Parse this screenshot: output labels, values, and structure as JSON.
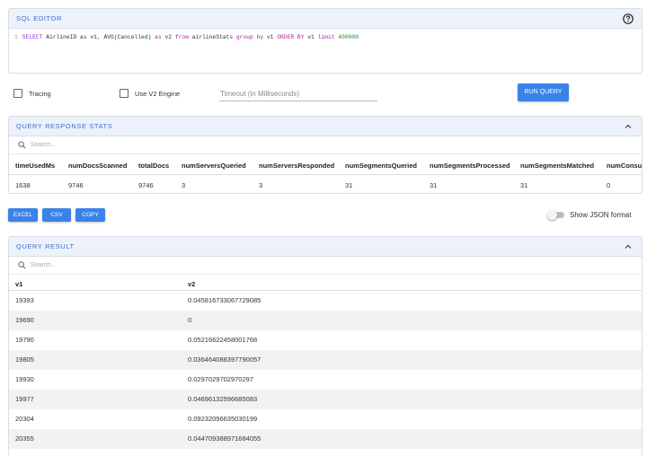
{
  "sql_editor": {
    "title": "SQL EDITOR",
    "line_number": "1",
    "query_tokens": {
      "select": "SELECT",
      "part1": " AirlineID as v1, AVG(Cancelled) ",
      "as2": "as",
      "v2": " v2 ",
      "from": "from",
      "table": " airlineStats ",
      "group": "group by",
      "v1a": " v1 ",
      "order": "ORDER BY",
      "v1b": " v1 ",
      "limit": "limit",
      "limit_value": " 400000"
    }
  },
  "options": {
    "tracing_label": "Tracing",
    "v2_engine_label": "Use V2 Engine",
    "timeout_placeholder": "Timeout (in Milliseconds)",
    "run_query_label": "RUN QUERY"
  },
  "stats": {
    "title": "QUERY RESPONSE STATS",
    "search_placeholder": "Search...",
    "headers": [
      "timeUsedMs",
      "numDocsScanned",
      "totalDocs",
      "numServersQueried",
      "numServersResponded",
      "numSegmentsQueried",
      "numSegmentsProcessed",
      "numSegmentsMatched",
      "numConsum"
    ],
    "values": [
      "1638",
      "9746",
      "9746",
      "3",
      "3",
      "31",
      "31",
      "31",
      "0"
    ]
  },
  "export": {
    "excel_label": "EXCEL",
    "csv_label": "CSV",
    "copy_label": "COPY",
    "json_toggle_label": "Show JSON format",
    "json_toggle_on": false
  },
  "result": {
    "title": "QUERY RESULT",
    "search_placeholder": "Search...",
    "headers": [
      "v1",
      "v2"
    ],
    "rows": [
      [
        "19393",
        "0.045816733067729085"
      ],
      [
        "19690",
        "0"
      ],
      [
        "19790",
        "0.05216622458001768"
      ],
      [
        "19805",
        "0.036464088397790057"
      ],
      [
        "19930",
        "0.0297029702970297"
      ],
      [
        "19977",
        "0.04696132596685083"
      ],
      [
        "20304",
        "0.09232096635030199"
      ],
      [
        "20355",
        "0.044709388971684055"
      ]
    ]
  },
  "colors": {
    "accent": "#3b82e8",
    "panel_header_bg": "#edf1fa",
    "title_blue": "#3b6fd4",
    "keyword_purple": "#8a2be2",
    "number_green": "#1a8a32"
  },
  "icons": {
    "help": "help-circle-icon",
    "collapse": "chevron-up-icon",
    "search": "search-icon"
  }
}
